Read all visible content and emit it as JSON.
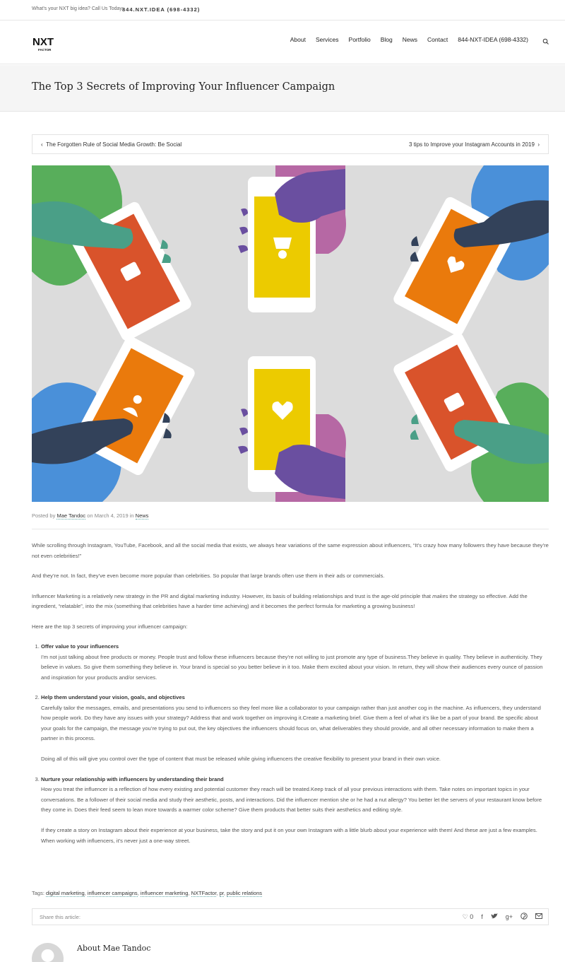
{
  "topbar": {
    "tagline": "What's your NXT big idea?  Call Us Today:",
    "phone": "844.NXT.IDEA (698-4332)"
  },
  "logo": {
    "text_top": "NXT",
    "text_bottom": "FACTOR"
  },
  "nav": [
    "About",
    "Services",
    "Portfolio",
    "Blog",
    "News",
    "Contact",
    "844-NXT-IDEA (698-4332)"
  ],
  "page_title": "The Top 3 Secrets of Improving Your Influencer Campaign",
  "postnav": {
    "prev": "The Forgotten Rule of Social Media Growth: Be Social",
    "next": "3 tips to Improve your Instagram Accounts in 2019"
  },
  "meta": {
    "posted_by": "Posted by",
    "author": "Mae Tandoc",
    "on": "on March 4, 2019 in",
    "category": "News"
  },
  "body": {
    "p1": "While scrolling through Instagram, YouTube, Facebook, and all the social media that exists, we always hear variations of the same expression about influencers, “It’s crazy how many followers they have because they’re not even celebrities!”",
    "p2": "And they’re not. In fact, they’ve even become more popular than celebrities. So popular that large brands often use them in their ads or commercials.",
    "p3a": "Influencer Marketing is a relatively new strategy in the PR and digital marketing industry. However, its basis of building relationships and trust is the age-old principle that ",
    "p3em": "makes",
    "p3b": " the strategy so effective. Add the ingredient, “relatable”, into the mix (something that celebrities have a harder time achieving) and it becomes the perfect formula for marketing a growing business!",
    "p4": "Here are the top 3 secrets of improving your influencer campaign:",
    "items": [
      {
        "title": "Offer value to your influencers",
        "text": "I’m not just talking about free products or money. People trust and follow these influencers because they’re not willing to just promote any type of business.They believe in quality. They believe in authenticity. They believe in values. So give them something they believe in. Your brand is special so you better believe in it too. Make them excited about your vision. In return, they will show their audiences every ounce of passion and inspiration for your products and/or services.",
        "extra": ""
      },
      {
        "title": "Help them understand your vision, goals, and objectives",
        "text": "Carefully tailor the messages, emails, and presentations you send to influencers so they feel more like a collaborator to your campaign rather than just another cog in the machine. As influencers, they understand how people work. Do they have any issues with your strategy? Address that and work together on improving it.Create a marketing brief. Give them a feel of what it’s like be a part of your brand. Be specific about your goals for the campaign, the message you’re trying to put out, the key objectives the influencers should focus on, what deliverables they should provide, and all other necessary information to make them a partner in this process.",
        "extra": "Doing all of this will give you control over the type of content that must be released while giving influencers the creative flexibility to present your brand in their own voice."
      },
      {
        "title": "Nurture your relationship with influencers by understanding their brand",
        "text": "How you treat the influencer is a reflection of how every existing and potential customer they reach will be treated.Keep track of all your previous interactions with them. Take notes on important topics in your conversations. Be a follower of their social media and study their aesthetic, posts, and interactions. Did the influencer mention she or he had a nut allergy? You better let the servers of your restaurant know before they come in. Does their feed seem to lean more towards a warmer color scheme? Give them products that better suits their aesthetics and editing style.",
        "extra": "If they create a story on Instagram about their experience at your business, take the story and put it on your own Instagram with a little blurb about your experience with them! And these are just a few examples. When working with influencers, it’s never just a one-way street."
      }
    ]
  },
  "tags": {
    "label": "Tags:",
    "items": [
      "digital marketing",
      "influencer campaigns",
      "influencer marketing",
      "NXTFactor",
      "pr",
      "public relations"
    ]
  },
  "share": {
    "label": "Share this article:",
    "likes": "0"
  },
  "author": {
    "heading": "About Mae Tandoc"
  },
  "colors": {
    "bg_gray": "#dcdcdc",
    "orange_red": "#d9532b",
    "orange": "#ea7a0c",
    "yellow": "#eccb00",
    "green": "#58ae5b",
    "teal": "#4a9f87",
    "blue": "#4a90d9",
    "purple": "#6a4fa0",
    "pink": "#b668a4",
    "navy": "#33425a"
  }
}
